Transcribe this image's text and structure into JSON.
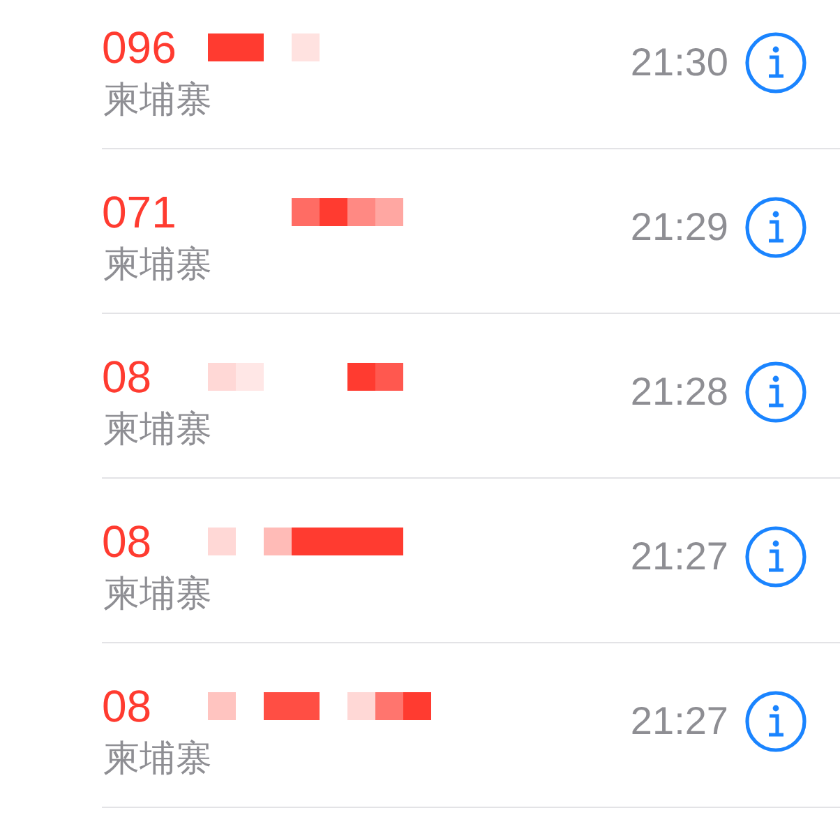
{
  "calls": [
    {
      "number": "096",
      "location": "柬埔寨",
      "time": "21:30",
      "missed": true
    },
    {
      "number": "071",
      "location": "柬埔寨",
      "time": "21:29",
      "missed": true
    },
    {
      "number": "08",
      "location": "柬埔寨",
      "time": "21:28",
      "missed": true
    },
    {
      "number": "08",
      "location": "柬埔寨",
      "time": "21:27",
      "missed": true
    },
    {
      "number": "08",
      "location": "柬埔寨",
      "time": "21:27",
      "missed": true
    }
  ]
}
